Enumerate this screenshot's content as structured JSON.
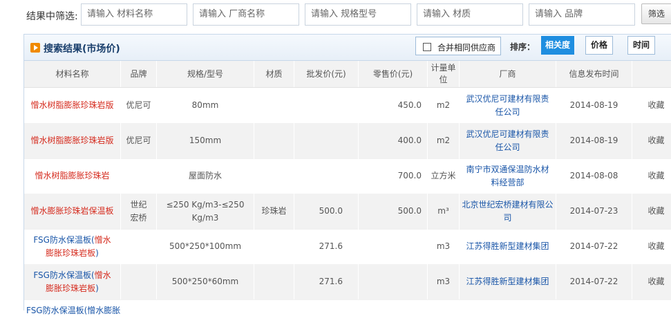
{
  "filter": {
    "label": "结果中筛选:",
    "inputs": [
      {
        "placeholder": "请输入 材料名称"
      },
      {
        "placeholder": "请输入 厂商名称"
      },
      {
        "placeholder": "请输入 规格型号"
      },
      {
        "placeholder": "请输入 材质"
      },
      {
        "placeholder": "请输入 品牌"
      }
    ],
    "button": "筛选"
  },
  "panel": {
    "title": "搜索结果(市场价)",
    "merge_label": "合并相同供应商",
    "sort_label": "排序：",
    "sort_options": [
      "相关度",
      "价格",
      "时间"
    ],
    "active_sort": "相关度"
  },
  "table": {
    "columns": [
      "材料名称",
      "品牌",
      "规格/型号",
      "材质",
      "批发价(元)",
      "零售价(元)",
      "计量单位",
      "厂商",
      "信息发布时间",
      ""
    ],
    "rows": [
      {
        "name": "憎水树脂膨胀珍珠岩版",
        "brand": "优尼可",
        "spec": "80mm",
        "material": "",
        "wholesale": "",
        "retail": "450.0",
        "unit": "m2",
        "vendor": "武汉优尼可建材有限责任公司",
        "date": "2014-08-19",
        "action": "收藏"
      },
      {
        "name": "憎水树脂膨胀珍珠岩版",
        "brand": "优尼可",
        "spec": "150mm",
        "material": "",
        "wholesale": "",
        "retail": "400.0",
        "unit": "m2",
        "vendor": "武汉优尼可建材有限责任公司",
        "date": "2014-08-19",
        "action": "收藏"
      },
      {
        "name": "憎水树脂膨胀珍珠岩",
        "brand": "",
        "spec": "屋面防水",
        "material": "",
        "wholesale": "",
        "retail": "700.0",
        "unit": "立方米",
        "vendor": "南宁市双通保温防水材料经营部",
        "date": "2014-08-08",
        "action": "收藏"
      },
      {
        "name": "憎水膨胀珍珠岩保温板",
        "brand": "世纪宏桥",
        "spec": "≤250 Kg/m3-≤250 Kg/m3",
        "material": "珍珠岩",
        "wholesale": "500.0",
        "retail": "500.0",
        "unit": "m³",
        "vendor": "北京世纪宏桥建材有限公司",
        "date": "2014-07-23",
        "action": "收藏"
      },
      {
        "name_prefix": "FSG防水保温板(",
        "name_main": "憎水膨胀珍珠岩板",
        "name_suffix": ")",
        "brand": "",
        "spec": "500*250*100mm",
        "material": "",
        "wholesale": "271.6",
        "retail": "",
        "unit": "m3",
        "vendor": "江苏得胜新型建材集团",
        "date": "2014-07-22",
        "action": "收藏"
      },
      {
        "name_prefix": "FSG防水保温板(",
        "name_main": "憎水膨胀珍珠岩板",
        "name_suffix": ")",
        "brand": "",
        "spec": "500*250*60mm",
        "material": "",
        "wholesale": "271.6",
        "retail": "",
        "unit": "m3",
        "vendor": "江苏得胜新型建材集团",
        "date": "2014-07-22",
        "action": "收藏"
      }
    ],
    "partial_row": "FSG防水保温板(憎水膨胀"
  },
  "colors": {
    "accent": "#1f8ee0",
    "link": "#1a56a8",
    "name": "#d52b1e",
    "header_icon": "#f08a00"
  }
}
